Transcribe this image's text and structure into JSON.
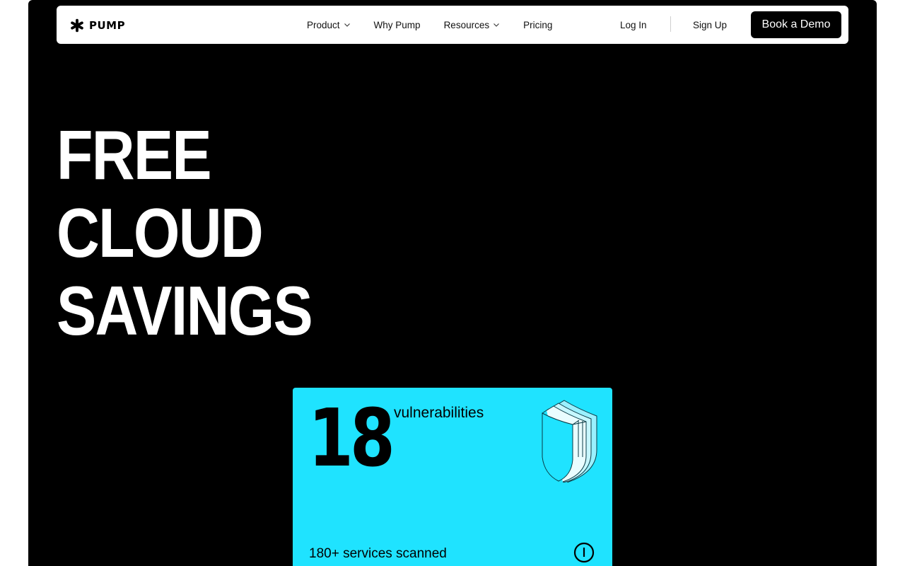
{
  "nav": {
    "logo_text": "PUMP",
    "links": [
      {
        "label": "Product",
        "has_dropdown": true
      },
      {
        "label": "Why Pump",
        "has_dropdown": false
      },
      {
        "label": "Resources",
        "has_dropdown": true
      },
      {
        "label": "Pricing",
        "has_dropdown": false
      }
    ],
    "login_label": "Log In",
    "signup_label": "Sign Up",
    "demo_label": "Book a Demo"
  },
  "hero": {
    "lines": [
      "FREE",
      "CLOUD",
      "SAVINGS"
    ]
  },
  "card": {
    "count": "18",
    "count_label": "vulnerabilities",
    "footer": "180+ services scanned",
    "background": "#1fe3ff",
    "icons": [
      "shield-icon",
      "info-icon"
    ]
  },
  "colors": {
    "page_bg": "#000000",
    "navbar_bg": "#ffffff",
    "accent": "#1fe3ff"
  }
}
